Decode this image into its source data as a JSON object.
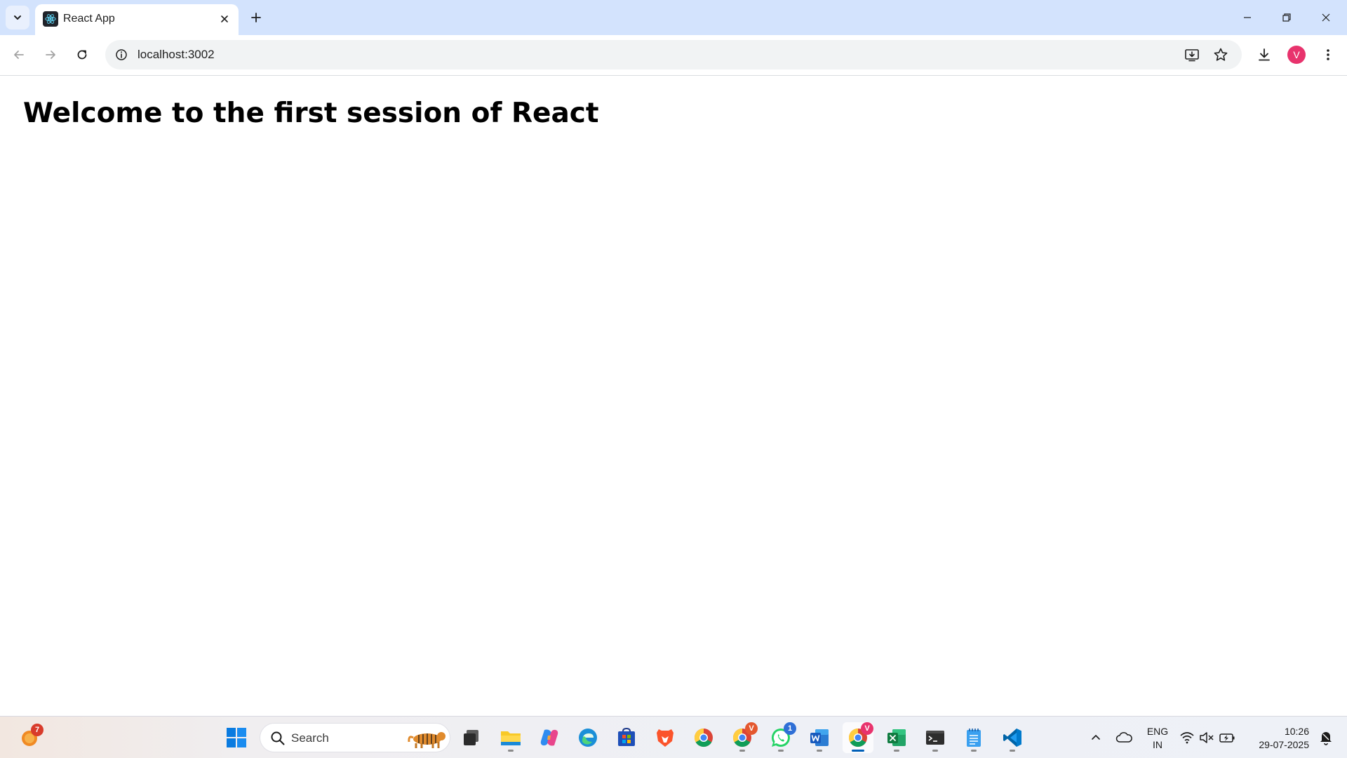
{
  "browser": {
    "tab": {
      "title": "React App",
      "favicon": "react-logo-icon"
    },
    "new_tab_icon": "plus-icon",
    "address": {
      "url": "localhost:3002"
    },
    "profile_initial": "V",
    "colors": {
      "tabstrip": "#d3e3fd",
      "avatar": "#e8336d"
    }
  },
  "page": {
    "heading": "Welcome to the first session of React"
  },
  "taskbar": {
    "weather_badge": "7",
    "search_placeholder": "Search",
    "apps": [
      {
        "name": "Task View"
      },
      {
        "name": "File Explorer"
      },
      {
        "name": "Copilot"
      },
      {
        "name": "Microsoft Edge"
      },
      {
        "name": "Microsoft Store"
      },
      {
        "name": "Brave"
      },
      {
        "name": "Google Chrome"
      },
      {
        "name": "Google Chrome profile",
        "badge": "V"
      },
      {
        "name": "WhatsApp",
        "badge": "1"
      },
      {
        "name": "Microsoft Word"
      },
      {
        "name": "Google Chrome (active)",
        "badge": "V"
      },
      {
        "name": "Microsoft Excel"
      },
      {
        "name": "Terminal"
      },
      {
        "name": "Notepad"
      },
      {
        "name": "Visual Studio Code"
      }
    ],
    "tray": {
      "language_line1": "ENG",
      "language_line2": "IN",
      "time": "10:26",
      "date": "29-07-2025"
    }
  }
}
